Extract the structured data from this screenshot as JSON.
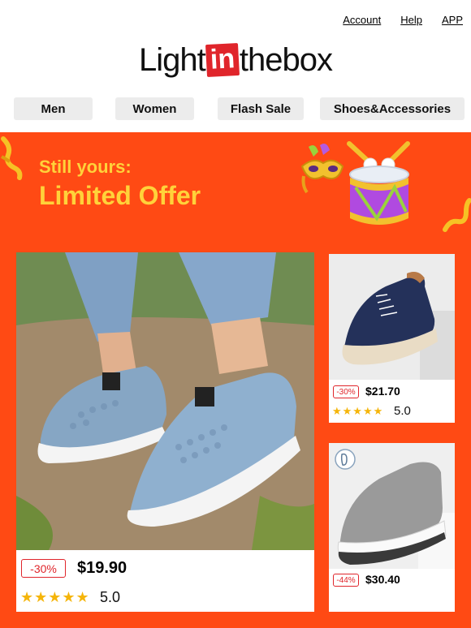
{
  "header": {
    "links": [
      "Account",
      "Help",
      "APP"
    ],
    "logo": {
      "part1": "Light",
      "part2": "in",
      "part3": "thebox"
    }
  },
  "nav": {
    "items": [
      "Men",
      "Women",
      "Flash Sale",
      "Shoes&Accessories"
    ]
  },
  "promo": {
    "kicker": "Still yours:",
    "headline": "Limited Offer",
    "colors": {
      "background": "#ff4a14",
      "headline": "#ffd23a",
      "accent_red": "#e0252b",
      "star": "#f5b50a"
    }
  },
  "products": [
    {
      "discount": "-30%",
      "price": "$19.90",
      "stars": "★★★★★",
      "rating": "5.0"
    },
    {
      "discount": "-30%",
      "price": "$21.70",
      "stars": "★★★★★",
      "rating": "5.0"
    },
    {
      "discount": "-44%",
      "price": "$30.40"
    }
  ]
}
